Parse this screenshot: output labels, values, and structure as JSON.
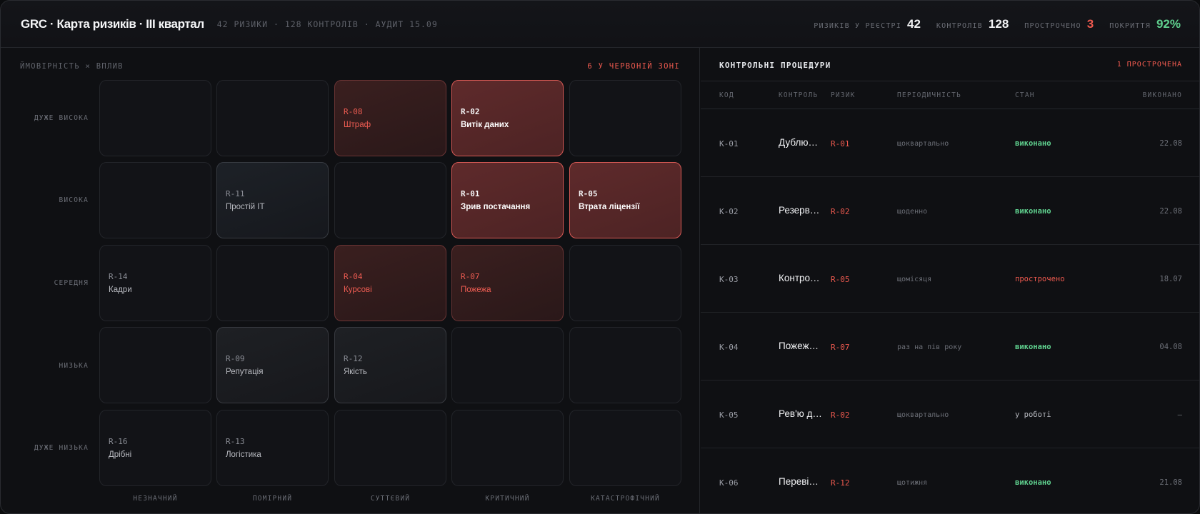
{
  "header": {
    "title": "GRC · Карта ризиків · III квартал",
    "subtitle": "42 РИЗИКИ · 128 КОНТРОЛІВ · АУДИТ 15.09",
    "stats": [
      {
        "label": "РИЗИКІВ У РЕЄСТРІ",
        "value": "42",
        "tone": "default"
      },
      {
        "label": "КОНТРОЛІВ",
        "value": "128",
        "tone": "default"
      },
      {
        "label": "ПРОСТРОЧЕНО",
        "value": "3",
        "tone": "red"
      },
      {
        "label": "ПОКРИТТЯ",
        "value": "92%",
        "tone": "green"
      }
    ]
  },
  "matrix": {
    "title": "ЙМОВІРНІСТЬ × ВПЛИВ",
    "red_zone_label": "6 У ЧЕРВОНІЙ ЗОНІ",
    "rows": [
      "ДУЖЕ ВИСОКА",
      "ВИСОКА",
      "СЕРЕДНЯ",
      "НИЗЬКА",
      "ДУЖЕ НИЗЬКА"
    ],
    "cols": [
      "НЕЗНАЧНИЙ",
      "ПОМІРНИЙ",
      "СУТТЄВИЙ",
      "КРИТИЧНИЙ",
      "КАТАСТРОФІЧНИЙ"
    ],
    "cells": [
      [
        null,
        null,
        {
          "code": "R-08",
          "name": "Штраф",
          "level": "dim"
        },
        {
          "code": "R-02",
          "name": "Витік даних",
          "level": "hot"
        },
        null
      ],
      [
        null,
        {
          "code": "R-11",
          "name": "Простій IT",
          "level": "gray-blue"
        },
        null,
        {
          "code": "R-01",
          "name": "Зрив постачання",
          "level": "hot"
        },
        {
          "code": "R-05",
          "name": "Втрата ліцензії",
          "level": "hot"
        }
      ],
      [
        {
          "code": "R-14",
          "name": "Кадри",
          "level": "plain"
        },
        null,
        {
          "code": "R-04",
          "name": "Курсові",
          "level": "dim"
        },
        {
          "code": "R-07",
          "name": "Пожежа",
          "level": "dim"
        },
        null
      ],
      [
        null,
        {
          "code": "R-09",
          "name": "Репутація",
          "level": "gray"
        },
        {
          "code": "R-12",
          "name": "Якість",
          "level": "gray"
        },
        null,
        null
      ],
      [
        {
          "code": "R-16",
          "name": "Дрібні",
          "level": "plain"
        },
        {
          "code": "R-13",
          "name": "Логістика",
          "level": "plain"
        },
        null,
        null,
        null
      ]
    ]
  },
  "controls": {
    "title": "КОНТРОЛЬНІ ПРОЦЕДУРИ",
    "overdue_note": "1 ПРОСТРОЧЕНА",
    "columns": [
      "КОД",
      "КОНТРОЛЬ",
      "РИЗИК",
      "ПЕРІОДИЧНІСТЬ",
      "СТАН",
      "ВИКОНАНО"
    ],
    "rows": [
      {
        "code": "K-01",
        "control": "Дублюв…",
        "risk": "R-01",
        "period": "щоквартально",
        "status": "виконано",
        "status_tone": "ok",
        "done": "22.08"
      },
      {
        "code": "K-02",
        "control": "Резерв…",
        "risk": "R-02",
        "period": "щоденно",
        "status": "виконано",
        "status_tone": "ok",
        "done": "22.08"
      },
      {
        "code": "K-03",
        "control": "Контро…",
        "risk": "R-05",
        "period": "щомісяця",
        "status": "прострочено",
        "status_tone": "late",
        "done": "18.07"
      },
      {
        "code": "K-04",
        "control": "Пожеж…",
        "risk": "R-07",
        "period": "раз на пів року",
        "status": "виконано",
        "status_tone": "ok",
        "done": "04.08"
      },
      {
        "code": "K-05",
        "control": "Рев'ю д…",
        "risk": "R-02",
        "period": "щоквартально",
        "status": "у роботі",
        "status_tone": "work",
        "done": "—"
      },
      {
        "code": "K-06",
        "control": "Перевір…",
        "risk": "R-12",
        "period": "щотижня",
        "status": "виконано",
        "status_tone": "ok",
        "done": "21.08"
      }
    ]
  },
  "colors": {
    "accent_red": "#ef5a4f",
    "accent_green": "#5fd08e",
    "background": "#0f1013"
  }
}
